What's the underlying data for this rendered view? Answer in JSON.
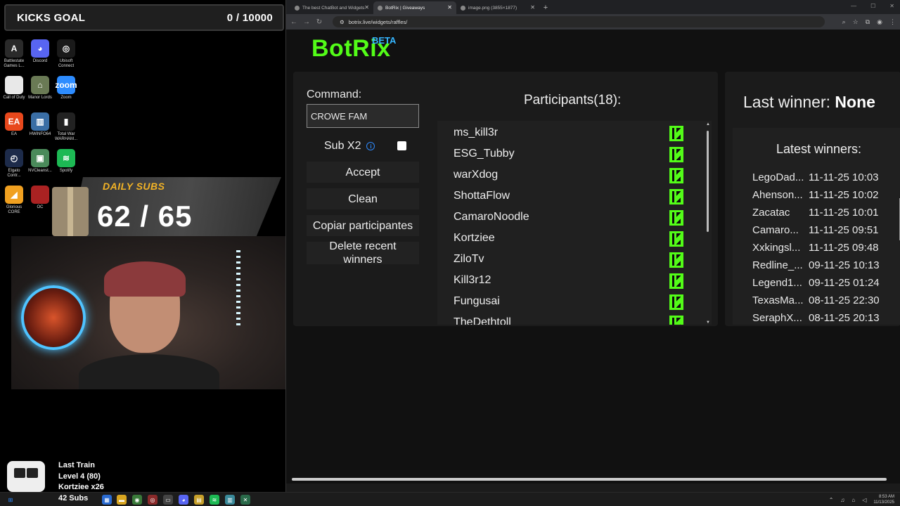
{
  "overlay": {
    "kicks_goal": {
      "label": "KICKS GOAL",
      "value": "0 / 10000"
    },
    "daily_subs": {
      "label": "DAILY SUBS",
      "value": "62 / 65"
    },
    "train": {
      "line1": "Last Train",
      "line2": "Level 4 (80)",
      "line3": "Kortziee x26"
    },
    "subs_count": "42 Subs"
  },
  "desktop_icons": [
    {
      "label": "Battlestate Games L...",
      "icon": "battlestate-icon",
      "color": "#2a2a2a",
      "glyph": "A"
    },
    {
      "label": "Discord",
      "icon": "discord-icon",
      "color": "#5865f2",
      "glyph": "◕"
    },
    {
      "label": "Ubisoft Connect",
      "icon": "ubisoft-icon",
      "color": "#1a1a1a",
      "glyph": "◎"
    },
    {
      "label": "Call of Duty",
      "icon": "call-of-duty-icon",
      "color": "#e8e8e8",
      "glyph": ""
    },
    {
      "label": "Manor Lords",
      "icon": "manor-lords-icon",
      "color": "#6a7a55",
      "glyph": "⌂"
    },
    {
      "label": "Zoom",
      "icon": "zoom-icon",
      "color": "#2d8cff",
      "glyph": "zoom"
    },
    {
      "label": "EA",
      "icon": "ea-icon",
      "color": "#e8481c",
      "glyph": "EA"
    },
    {
      "label": "HWiNFO64",
      "icon": "hwinfo-icon",
      "color": "#3a6ea5",
      "glyph": "▥"
    },
    {
      "label": "Total War WARHAM...",
      "icon": "total-war-icon",
      "color": "#222",
      "glyph": "▮"
    },
    {
      "label": "Elgato Contr...",
      "icon": "elgato-icon",
      "color": "#1d2b4a",
      "glyph": "◴"
    },
    {
      "label": "NVCleanst...",
      "icon": "nvcleanstall-icon",
      "color": "#4a8a5a",
      "glyph": "▣"
    },
    {
      "label": "Spotify",
      "icon": "spotify-icon",
      "color": "#1db954",
      "glyph": "≋"
    },
    {
      "label": "Glorious CORE",
      "icon": "glorious-icon",
      "color": "#f0a020",
      "glyph": "◢"
    },
    {
      "label": "OC",
      "icon": "oc-icon",
      "color": "#aa2222",
      "glyph": ""
    }
  ],
  "browser": {
    "tabs": [
      {
        "label": "The best ChatBot and Widgets",
        "active": false
      },
      {
        "label": "BotRix | Giveaways",
        "active": true
      },
      {
        "label": "image.png (3855×1877)",
        "active": false
      }
    ],
    "url": "botrix.live/widgets/raffles/"
  },
  "app": {
    "brand": "BotRix",
    "beta": "BETA",
    "command_label": "Command:",
    "command_value": "CROWE FAM",
    "sub_x2_label": "Sub X2",
    "buttons": {
      "accept": "Accept",
      "clean": "Clean",
      "copy": "Copiar participantes",
      "delete": "Delete recent winners"
    },
    "participants_title": "Participants(18):",
    "participants": [
      "ms_kill3r",
      "ESG_Tubby",
      "warXdog",
      "ShottaFlow",
      "CamaroNoodle",
      "Kortziee",
      "ZiloTv",
      "Kill3r12",
      "Fungusai",
      "TheDethtoll"
    ],
    "last_winner_label": "Last winner:",
    "last_winner_value": "None",
    "latest_winners_title": "Latest winners:",
    "latest_winners": [
      {
        "name": "LegoDad...",
        "date": "11-11-25 10:03"
      },
      {
        "name": "Ahenson...",
        "date": "11-11-25 10:02"
      },
      {
        "name": "Zacatac",
        "date": "11-11-25 10:01"
      },
      {
        "name": "Camaro...",
        "date": "11-11-25 09:51"
      },
      {
        "name": "Xxkingsl...",
        "date": "11-11-25 09:48"
      },
      {
        "name": "Redline_...",
        "date": "09-11-25 10:13"
      },
      {
        "name": "Legend1...",
        "date": "09-11-25 01:24"
      },
      {
        "name": "TexasMa...",
        "date": "08-11-25 22:30"
      },
      {
        "name": "SeraphX...",
        "date": "08-11-25 20:13"
      }
    ]
  },
  "taskbar": {
    "time": "8:53 AM",
    "date": "11/13/2025"
  }
}
